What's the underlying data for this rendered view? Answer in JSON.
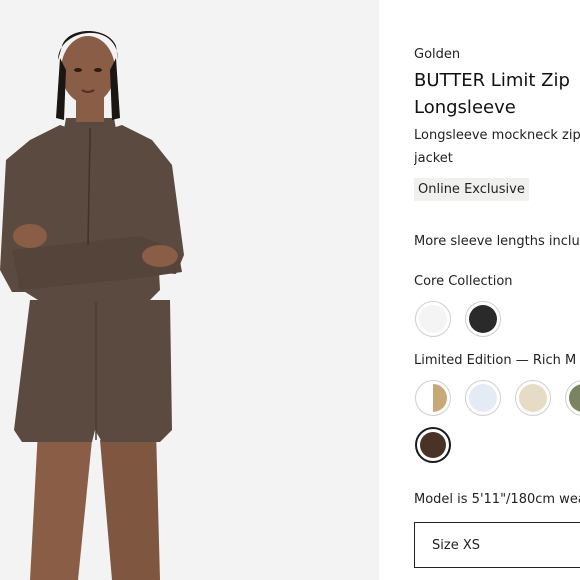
{
  "product": {
    "brand": "Golden",
    "title": "BUTTER Limit Zip Longsleeve",
    "subtitle": "Longsleeve mockneck zip jacket",
    "badge": "Online Exclusive",
    "sleeve_note": "More sleeve lengths inclu"
  },
  "core_collection": {
    "label": "Core Collection",
    "swatches": [
      {
        "name": "white",
        "color": "#f4f4f4"
      },
      {
        "name": "black",
        "color": "#2a2a2a"
      }
    ]
  },
  "limited_edition": {
    "label": "Limited Edition — Rich M",
    "swatches": [
      {
        "name": "tan-white split",
        "color": "#c8a877"
      },
      {
        "name": "pale blue",
        "color": "#e4ebf5"
      },
      {
        "name": "cream",
        "color": "#e6dcc6"
      },
      {
        "name": "olive",
        "color": "#7a8462"
      },
      {
        "name": "brown",
        "color": "#4a3226"
      }
    ]
  },
  "model_note": "Model is 5'11\"/180cm wea",
  "size": {
    "label": "Size XS"
  },
  "colors": {
    "garment": "#5b4a3f",
    "background": "#f3f3f3"
  }
}
